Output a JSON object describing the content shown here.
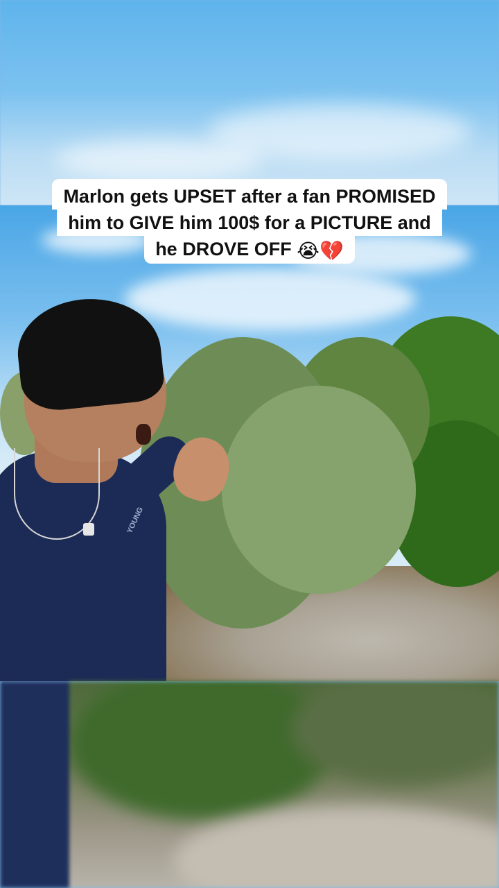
{
  "caption": {
    "line1": "Marlon gets UPSET after a fan PROMISED",
    "line2": "him to GIVE him 100$ for a PICTURE and",
    "line3": "he DROVE OFF",
    "emoji_crying": "😭",
    "emoji_broken_heart": "💔"
  },
  "shirt_logo_text": "YOUNG"
}
